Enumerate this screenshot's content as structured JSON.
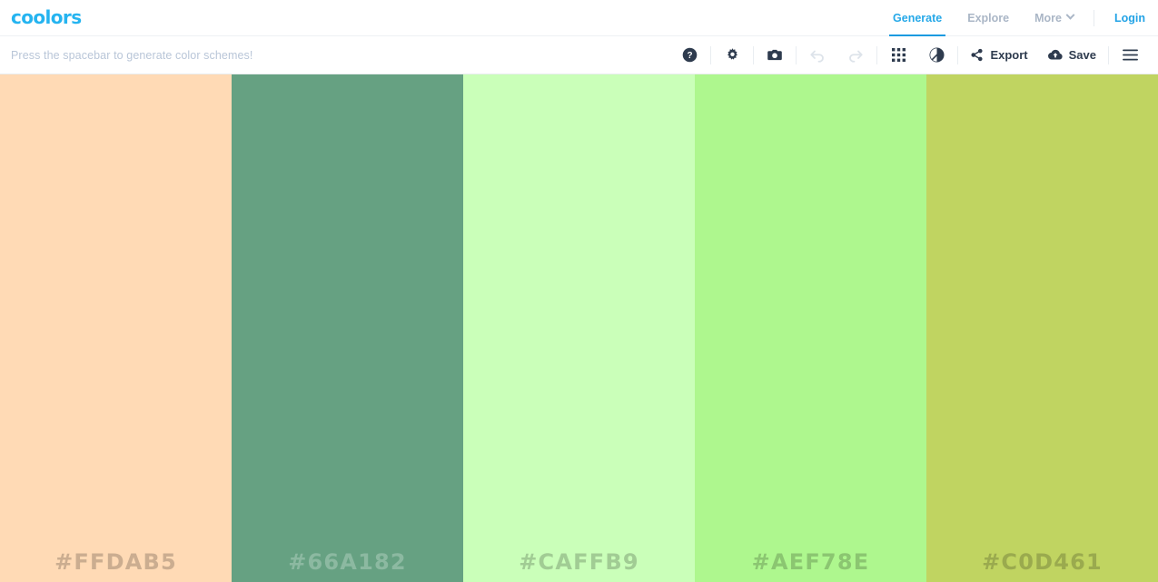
{
  "header": {
    "logo": "coolors",
    "nav": [
      {
        "label": "Generate",
        "active": true
      },
      {
        "label": "Explore",
        "active": false
      },
      {
        "label": "More",
        "active": false,
        "has_chevron": true
      }
    ],
    "login_label": "Login",
    "accent_color": "#25b4f0"
  },
  "toolbar": {
    "hint": "Press the spacebar to generate color schemes!",
    "icons": [
      {
        "name": "help-icon",
        "enabled": true
      },
      {
        "name": "gear-icon",
        "enabled": true
      },
      {
        "name": "camera-icon",
        "enabled": true
      },
      {
        "name": "undo-icon",
        "enabled": false
      },
      {
        "name": "redo-icon",
        "enabled": false
      },
      {
        "name": "grid-icon",
        "enabled": true
      },
      {
        "name": "contrast-icon",
        "enabled": true
      }
    ],
    "export_label": "Export",
    "save_label": "Save"
  },
  "palette": {
    "colors": [
      {
        "hex": "#FFDAB5",
        "label": "#FFDAB5",
        "text_color": "#cbad90"
      },
      {
        "hex": "#66A182",
        "label": "#66A182",
        "text_color": "#8cb9a1"
      },
      {
        "hex": "#CAFFB9",
        "label": "#CAFFB9",
        "text_color": "#a1cc94"
      },
      {
        "hex": "#AEF78E",
        "label": "#AEF78E",
        "text_color": "#8bc671"
      },
      {
        "hex": "#C0D461",
        "label": "#C0D461",
        "text_color": "#9aaa4e"
      }
    ]
  }
}
